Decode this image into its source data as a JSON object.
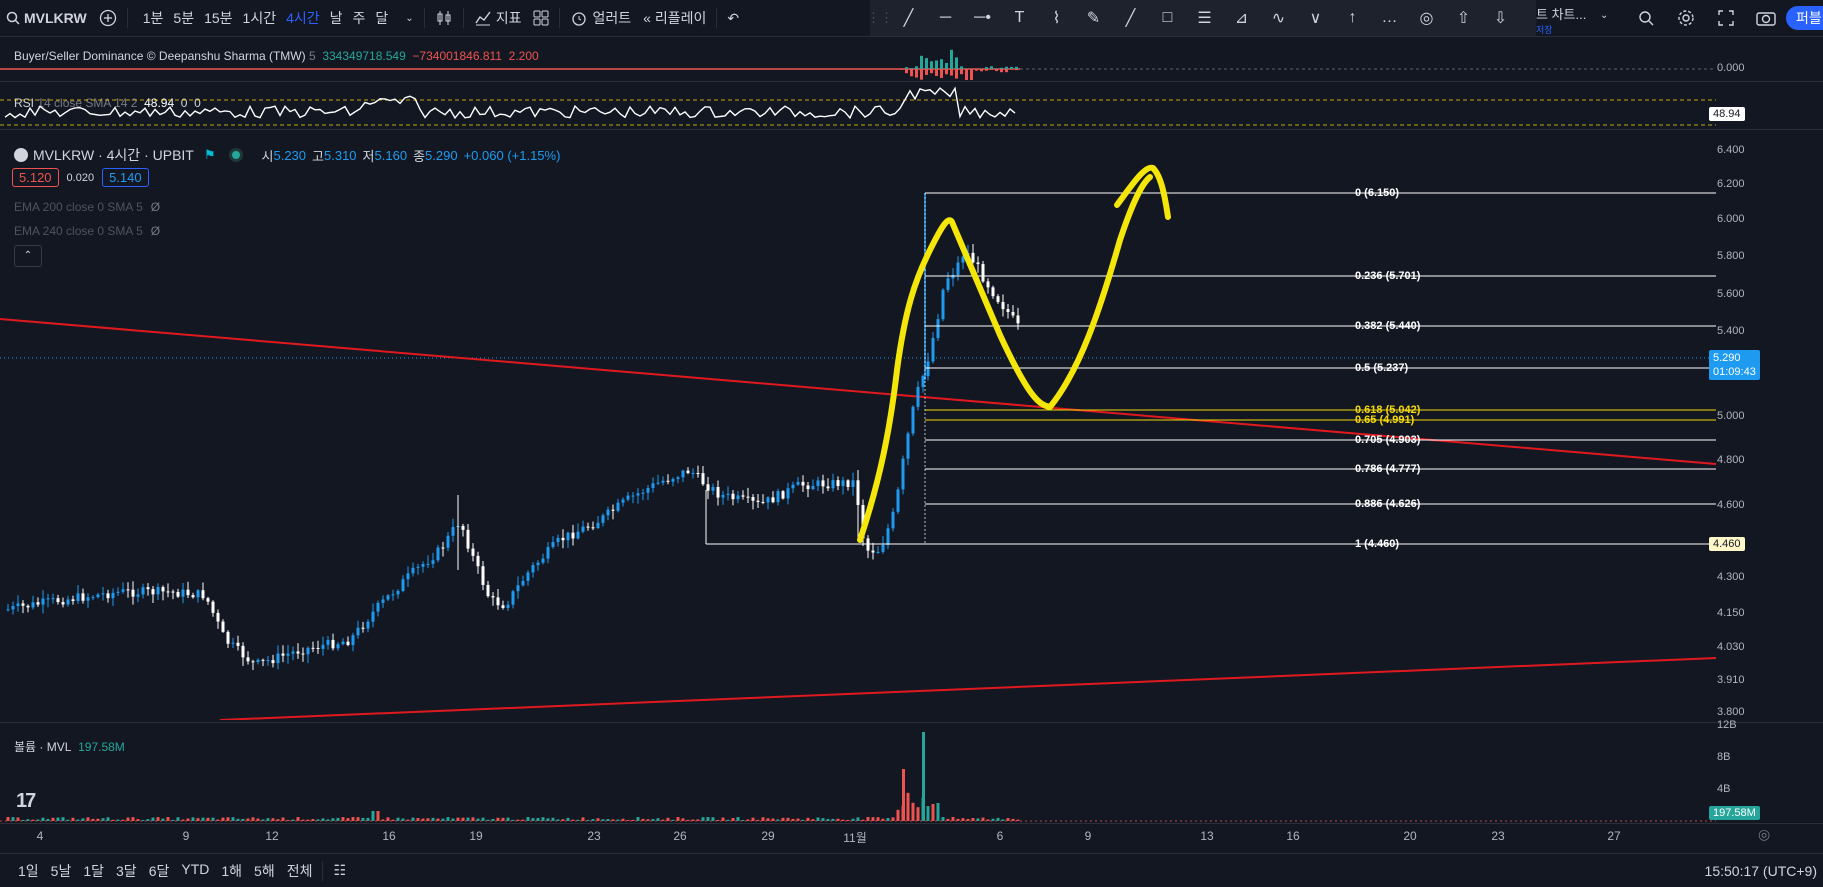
{
  "toolbar": {
    "symbol": "MVLKRW",
    "timeframes": [
      "1분",
      "5분",
      "15분",
      "1시간",
      "4시간",
      "날",
      "주",
      "달"
    ],
    "active_timeframe": "4시간",
    "indicators_label": "지표",
    "alert_label": "얼러트",
    "replay_label": "리플레이",
    "layout_label": "트 차트...",
    "layout_sub": "저장",
    "publish_label": "퍼블"
  },
  "panes": {
    "bsd": {
      "name": "Buyer/Seller Dominance © Deepanshu Sharma (TMW)",
      "param": "5",
      "v1": "334349718.549",
      "v2": "−734001846.811",
      "v3": "2.200",
      "axis": "0.000"
    },
    "rsi": {
      "name": "RSI",
      "params": "14 close SMA 14 2",
      "value": "48.94",
      "v2": "0",
      "v3": "0"
    },
    "main": {
      "title": "MVLKRW · 4시간 · UPBIT",
      "o_label": "시",
      "o": "5.230",
      "h_label": "고",
      "h": "5.310",
      "l_label": "저",
      "l": "5.160",
      "c_label": "종",
      "c": "5.290",
      "change": "+0.060 (+1.15%)",
      "bid": "5.120",
      "spread": "0.020",
      "ask": "5.140",
      "ema1": "EMA 200 close 0 SMA 5",
      "ema2": "EMA 240 close 0 SMA 5",
      "price_badge": "5.290",
      "countdown": "01:09:43",
      "fib_badge": "4.460"
    },
    "volume": {
      "name": "볼륨 · MVL",
      "value": "197.58M",
      "axis_ticks": [
        "12B",
        "8B",
        "4B"
      ]
    }
  },
  "price_axis": [
    "6.400",
    "6.200",
    "6.000",
    "5.800",
    "5.600",
    "5.400",
    "5.000",
    "4.800",
    "4.600",
    "4.300",
    "4.150",
    "4.030",
    "3.910",
    "3.800"
  ],
  "fib_levels": [
    {
      "label": "0 (6.150)",
      "color": "#ffffff"
    },
    {
      "label": "0.236 (5.701)",
      "color": "#ffffff"
    },
    {
      "label": "0.382 (5.440)",
      "color": "#ffffff"
    },
    {
      "label": "0.5 (5.237)",
      "color": "#ffffff"
    },
    {
      "label": "0.618 (5.042)",
      "color": "#f5d90a"
    },
    {
      "label": "0.65 (4.991)",
      "color": "#f5d90a"
    },
    {
      "label": "0.705 (4.903)",
      "color": "#ffffff"
    },
    {
      "label": "0.786 (4.777)",
      "color": "#ffffff"
    },
    {
      "label": "0.886 (4.626)",
      "color": "#ffffff"
    },
    {
      "label": "1 (4.460)",
      "color": "#ffffff"
    }
  ],
  "time_axis": [
    "4",
    "9",
    "12",
    "16",
    "19",
    "23",
    "26",
    "29",
    "11월",
    "6",
    "9",
    "13",
    "16",
    "20",
    "23",
    "27"
  ],
  "bottom": {
    "ranges": [
      "1일",
      "5날",
      "1달",
      "3달",
      "6달",
      "YTD",
      "1해",
      "5해",
      "전체"
    ],
    "clock": "15:50:17 (UTC+9)"
  },
  "colors": {
    "bg": "#131722",
    "up": "#26a69a",
    "down": "#ef5350",
    "accent": "#2962ff",
    "trend": "#e0191f",
    "annotation": "#f5e60a",
    "price": "#1e9bf0"
  }
}
